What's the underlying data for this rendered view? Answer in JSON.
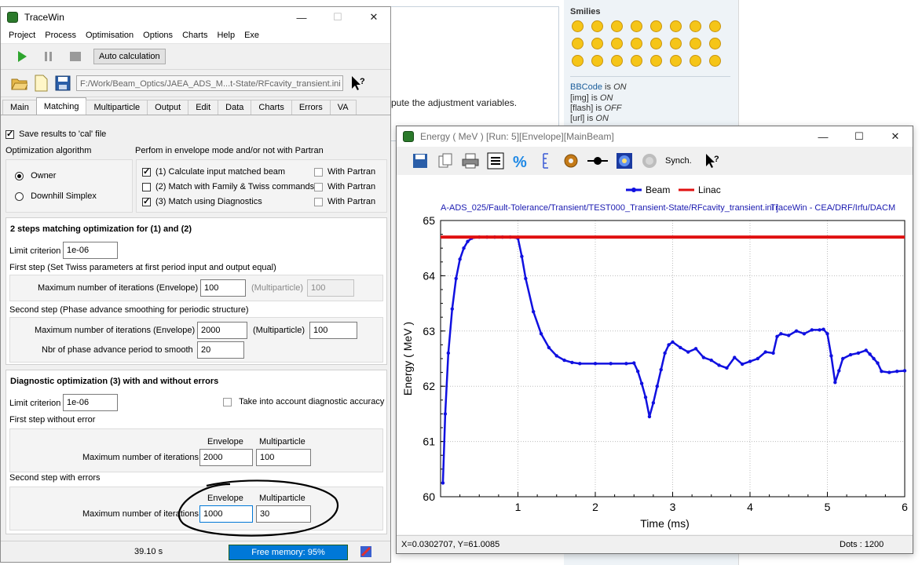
{
  "background_page": {
    "instruction_text": "pute the adjustment variables.",
    "smilies_title": "Smilies",
    "bbcode": [
      {
        "name": "BBCode",
        "state": "ON"
      },
      {
        "name": "[img]",
        "state": "ON"
      },
      {
        "name": "[flash]",
        "state": "OFF"
      },
      {
        "name": "[url]",
        "state": "ON"
      }
    ],
    "is_word": "is"
  },
  "tracewin": {
    "title": "TraceWin",
    "menu": [
      "Project",
      "Process",
      "Optimisation",
      "Options",
      "Charts",
      "Help",
      "Exe"
    ],
    "auto_calc_label": "Auto calculation",
    "project_path": "F:/Work/Beam_Optics/JAEA_ADS_M...t-State/RFcavity_transient.ini",
    "tabs": [
      "Main",
      "Matching",
      "Multiparticle",
      "Output",
      "Edit",
      "Data",
      "Charts",
      "Errors",
      "VA"
    ],
    "active_tab": "Matching",
    "save_results_label": "Save results to 'cal' file",
    "algo_title": "Optimization algorithm",
    "algo_options": [
      "Owner",
      "Downhill Simplex"
    ],
    "envelope_mode_title": "Perfom in envelope mode and/or not with Partran",
    "calc_options": [
      {
        "label": "(1) Calculate input matched beam",
        "checked": true,
        "partran_label": "With Partran",
        "partran": false
      },
      {
        "label": "(2) Match with Family & Twiss commands",
        "checked": false,
        "partran_label": "With Partran",
        "partran": false
      },
      {
        "label": "(3) Match using Diagnostics",
        "checked": true,
        "partran_label": "With Partran",
        "partran": false
      }
    ],
    "two_steps": {
      "title": "2 steps matching optimization for (1) and (2)",
      "limit_label": "Limit criterion",
      "limit_value": "1e-06",
      "first_step_label": "First step (Set Twiss parameters at first period input and output equal)",
      "max_iter_env_label": "Maximum number of iterations (Envelope)",
      "first_env_value": "100",
      "multiparticle_label": "(Multiparticle)",
      "first_multi_value": "100",
      "second_step_label": "Second step (Phase advance smoothing for periodic structure)",
      "second_env_value": "2000",
      "second_multi_label": "(Multiparticle)",
      "second_multi_value": "100",
      "nbr_phase_label": "Nbr of phase advance period to smooth",
      "nbr_phase_value": "20"
    },
    "diag": {
      "title": "Diagnostic optimization (3) with and without errors",
      "limit_label": "Limit criterion",
      "limit_value": "1e-06",
      "take_into_account_label": "Take into account diagnostic accuracy",
      "first_step_label": "First step without error",
      "envelope_header": "Envelope",
      "multiparticle_header": "Multiparticle",
      "max_iter_label": "Maximum number of iterations",
      "first_env_value": "2000",
      "first_multi_value": "100",
      "second_step_label": "Second step with errors",
      "second_env_value": "1000",
      "second_multi_value": "30"
    },
    "status": {
      "time": "39.10 s",
      "memory": "Free memory: 95%"
    }
  },
  "energy_window": {
    "title": "Energy ( MeV ) [Run: 5][Envelope][MainBeam]",
    "synch_label": "Synch.",
    "path_text": "A-ADS_025/Fault-Tolerance/Transient/TEST000_Transient-State/RFcavity_transient.ini ]",
    "credit_text": "TraceWin - CEA/DRF/Irfu/DACM",
    "coords": "X=0.0302707, Y=61.0085",
    "dots": "Dots : 1200"
  },
  "chart_data": {
    "type": "line",
    "xlabel": "Time (ms)",
    "ylabel": "Energy ( MeV )",
    "xlim": [
      0,
      6
    ],
    "ylim": [
      60,
      65
    ],
    "xticks": [
      1,
      2,
      3,
      4,
      5,
      6
    ],
    "yticks": [
      60,
      61,
      62,
      63,
      64,
      65
    ],
    "grid": true,
    "legend_position": "top",
    "series": [
      {
        "name": "Beam",
        "color": "#1010e0",
        "x": [
          0.03,
          0.06,
          0.1,
          0.15,
          0.2,
          0.25,
          0.3,
          0.35,
          0.4,
          0.5,
          0.6,
          0.7,
          0.8,
          0.9,
          1.0,
          1.05,
          1.1,
          1.2,
          1.3,
          1.4,
          1.5,
          1.6,
          1.7,
          1.8,
          2.0,
          2.2,
          2.4,
          2.5,
          2.55,
          2.6,
          2.65,
          2.7,
          2.75,
          2.8,
          2.85,
          2.9,
          2.95,
          3.0,
          3.1,
          3.2,
          3.3,
          3.4,
          3.5,
          3.6,
          3.7,
          3.8,
          3.9,
          4.0,
          4.1,
          4.2,
          4.3,
          4.35,
          4.4,
          4.5,
          4.6,
          4.7,
          4.8,
          4.9,
          4.95,
          5.0,
          5.05,
          5.1,
          5.15,
          5.2,
          5.3,
          5.4,
          5.5,
          5.55,
          5.6,
          5.65,
          5.7,
          5.8,
          5.9,
          6.0
        ],
        "y": [
          60.25,
          61.5,
          62.6,
          63.4,
          63.95,
          64.3,
          64.5,
          64.62,
          64.68,
          64.7,
          64.7,
          64.7,
          64.7,
          64.7,
          64.68,
          64.35,
          63.95,
          63.35,
          62.95,
          62.7,
          62.55,
          62.47,
          62.43,
          62.41,
          62.41,
          62.41,
          62.41,
          62.42,
          62.27,
          62.05,
          61.8,
          61.45,
          61.7,
          62.0,
          62.3,
          62.6,
          62.75,
          62.8,
          62.7,
          62.62,
          62.68,
          62.52,
          62.47,
          62.38,
          62.33,
          62.52,
          62.4,
          62.45,
          62.5,
          62.62,
          62.6,
          62.9,
          62.95,
          62.92,
          63.0,
          62.95,
          63.02,
          63.02,
          63.03,
          62.95,
          62.55,
          62.07,
          62.28,
          62.5,
          62.57,
          62.6,
          62.65,
          62.58,
          62.5,
          62.42,
          62.27,
          62.25,
          62.27,
          62.28
        ]
      },
      {
        "name": "Linac",
        "color": "#e01010",
        "x": [
          0,
          6
        ],
        "y": [
          64.7,
          64.7
        ]
      }
    ]
  }
}
